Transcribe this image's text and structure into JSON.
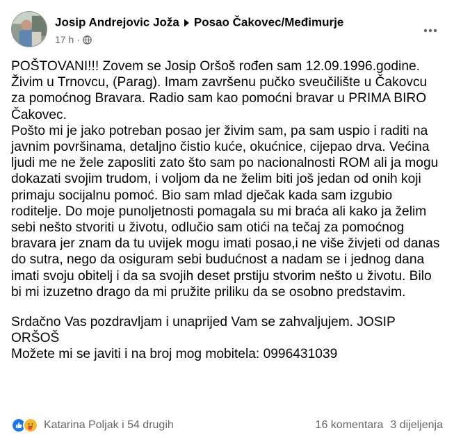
{
  "post": {
    "author": "Josip Andrejovic Joža",
    "group": "Posao Čakovec/Međimurje",
    "time": "17 h",
    "dot": "·",
    "paragraphs": [
      "POŠTOVANI!!! Zovem se Josip Oršoš rođen sam 12.09.1996.godine. Živim u Trnovcu, (Parag). Imam završenu pučko sveučilište u Čakovcu za pomoćnog Bravara.  Radio sam kao pomoćni bravar u PRIMA BIRO Čakovec.",
      "Pošto mi je jako potreban posao jer živim sam, pa sam uspio i raditi na javnim površinama, detaljno čistio kuće, okućnice, cijepao drva. Većina ljudi me ne žele zaposliti zato što sam po nacionalnosti ROM ali ja mogu dokazati svojim trudom, i voljom da ne želim biti još jedan od onih koji primaju socijalnu pomoć. Bio sam mlad dječak kada sam izgubio roditelje. Do moje punoljetnosti pomagala su mi braća ali kako ja želim sebi nešto stvoriti u životu, odlučio sam otići na tečaj za pomoćnog bravara jer znam da tu uvijek mogu imati posao,i ne više živjeti od danas do sutra, nego da osiguram sebi budućnost a nadam se i jednog dana imati svoju obitelj i da sa svojih deset prstiju stvorim nešto u životu. Bilo bi mi izuzetno drago da mi pružite priliku da se osobno predstavim.",
      "Srdačno Vas pozdravljam i unaprijed Vam se zahvaljujem. JOSIP ORŠOŠ",
      "Možete mi se javiti i na broj mog mobitela: 0996431039"
    ]
  },
  "footer": {
    "reactions_text": "Katarina Poljak i 54 drugih",
    "comments": "16 komentara",
    "shares": "3 dijeljenja"
  },
  "icons": {
    "author_arrow": "caret-right-icon",
    "privacy": "globe-icon",
    "more": "more-dots-icon",
    "reactions": [
      "like-icon",
      "care-icon"
    ]
  },
  "colors": {
    "text": "#050505",
    "secondary": "#65676b",
    "like_blue": "#1877f2",
    "care_yellow": "#f7b928"
  }
}
